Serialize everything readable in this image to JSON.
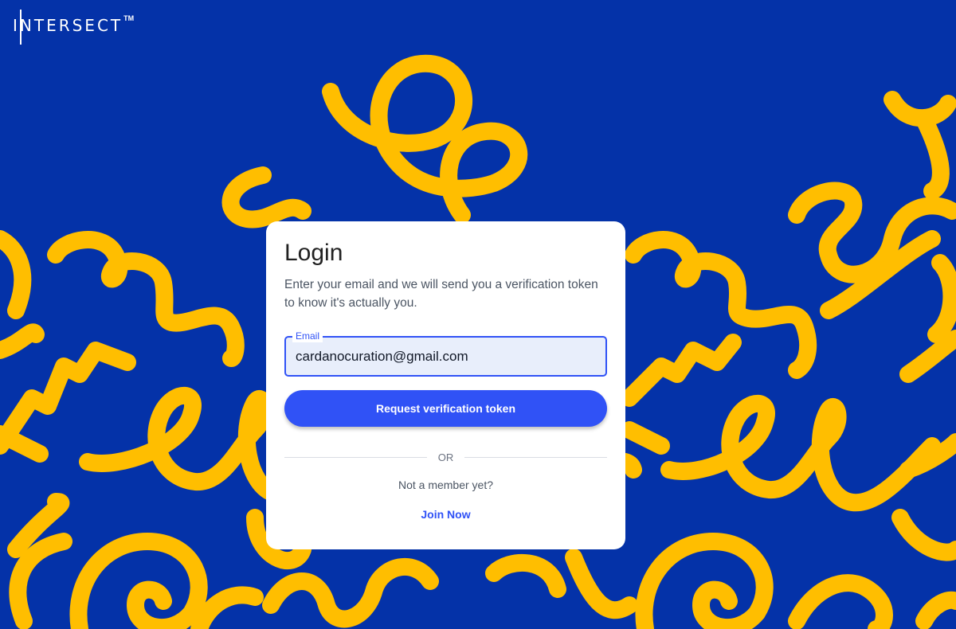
{
  "brand": {
    "logo_text": "INTERSECT",
    "logo_tm": "TM"
  },
  "colors": {
    "background": "#0432A8",
    "squiggle": "#FFBE00",
    "accent": "#3052F6",
    "card": "#ffffff"
  },
  "login": {
    "title": "Login",
    "description": "Enter your email and we will send you a verification token to know it's actually you.",
    "email_label": "Email",
    "email_value": "cardanocuration@gmail.com",
    "submit_label": "Request verification token",
    "divider_text": "OR",
    "not_member_text": "Not a member yet?",
    "join_label": "Join Now"
  }
}
